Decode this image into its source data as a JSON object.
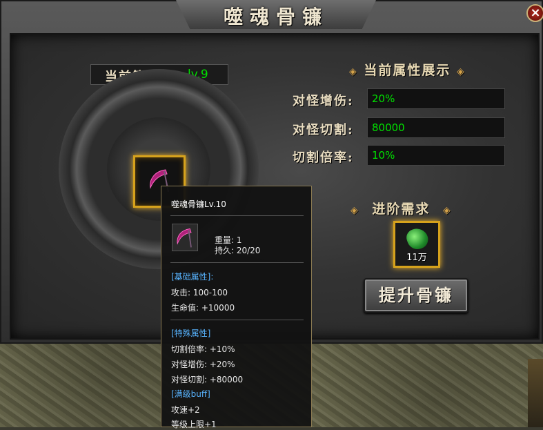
{
  "window": {
    "title": "噬魂骨镰",
    "close_symbol": "×"
  },
  "level": {
    "label": "当前等级:",
    "value": "lv.9"
  },
  "attributes": {
    "title": "当前属性展示",
    "deco": "◈",
    "items": [
      {
        "label": "对怪增伤:",
        "value": "20%"
      },
      {
        "label": "对怪切割:",
        "value": "80000"
      },
      {
        "label": "切割倍率:",
        "value": "10%"
      }
    ]
  },
  "requirement": {
    "title": "进阶需求",
    "quantity": "11万"
  },
  "upgrade_button": {
    "label": "提升骨镰"
  },
  "tooltip": {
    "name": "噬魂骨镰Lv.10",
    "weight": "重量:  1",
    "durability": "持久:  20/20",
    "base_header": "[基础属性]:",
    "base_attrs": [
      "攻击:  100-100",
      "生命值:  +10000"
    ],
    "special_header": "[特殊属性]",
    "special_attrs": [
      "切割倍率:  +10%",
      "对怪增伤:  +20%",
      "对怪切割:  +80000"
    ],
    "buff_header": "[满级buff]",
    "buff_attrs": [
      "攻速+2",
      "等级上限+1"
    ]
  },
  "colors": {
    "value_green": "#00e000",
    "gold_border": "#d6a21c",
    "tooltip_header_blue": "#58b4ff"
  }
}
